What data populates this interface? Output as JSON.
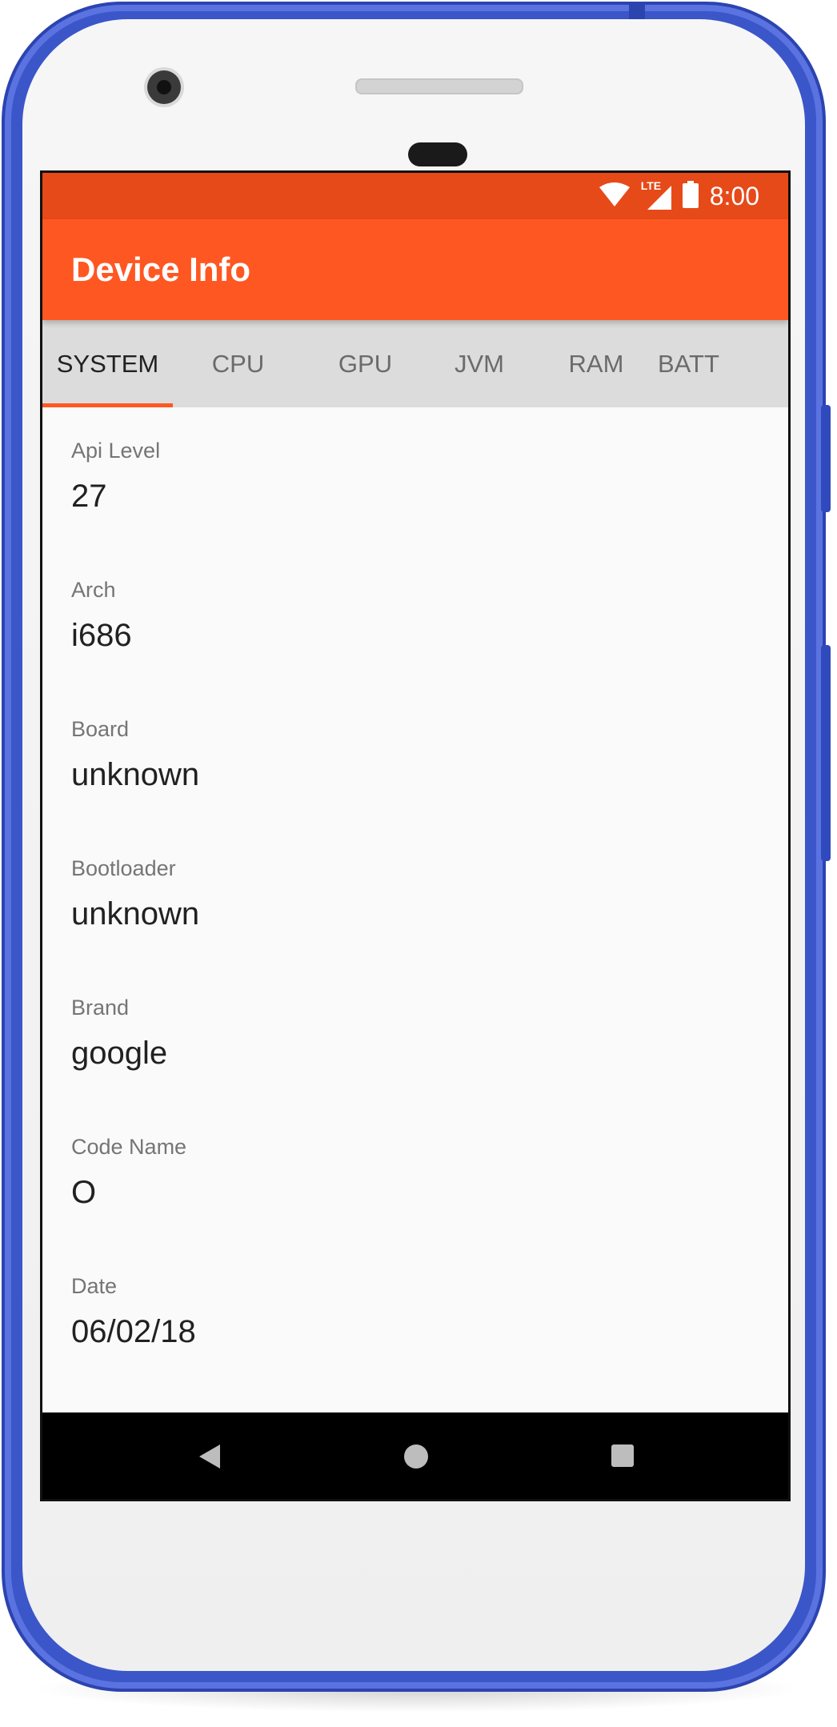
{
  "status_bar": {
    "time": "8:00",
    "network": "LTE",
    "icons": [
      "wifi-icon",
      "lte-signal-icon",
      "battery-icon"
    ]
  },
  "app_bar": {
    "title": "Device Info",
    "color": "#ff5722",
    "status_color": "#e64a19"
  },
  "tabs": [
    {
      "label": "SYSTEM",
      "active": true
    },
    {
      "label": "CPU",
      "active": false
    },
    {
      "label": "GPU",
      "active": false
    },
    {
      "label": "JVM",
      "active": false
    },
    {
      "label": "RAM",
      "active": false
    },
    {
      "label": "BATT",
      "active": false
    }
  ],
  "info": [
    {
      "label": "Api Level",
      "value": "27"
    },
    {
      "label": "Arch",
      "value": "i686"
    },
    {
      "label": "Board",
      "value": "unknown"
    },
    {
      "label": "Bootloader",
      "value": "unknown"
    },
    {
      "label": "Brand",
      "value": "google"
    },
    {
      "label": "Code Name",
      "value": "O"
    },
    {
      "label": "Date",
      "value": "06/02/18"
    }
  ],
  "nav_bar": {
    "icons": [
      "back-icon",
      "home-icon",
      "recents-icon"
    ]
  },
  "device_frame_color": "#3b56c9"
}
